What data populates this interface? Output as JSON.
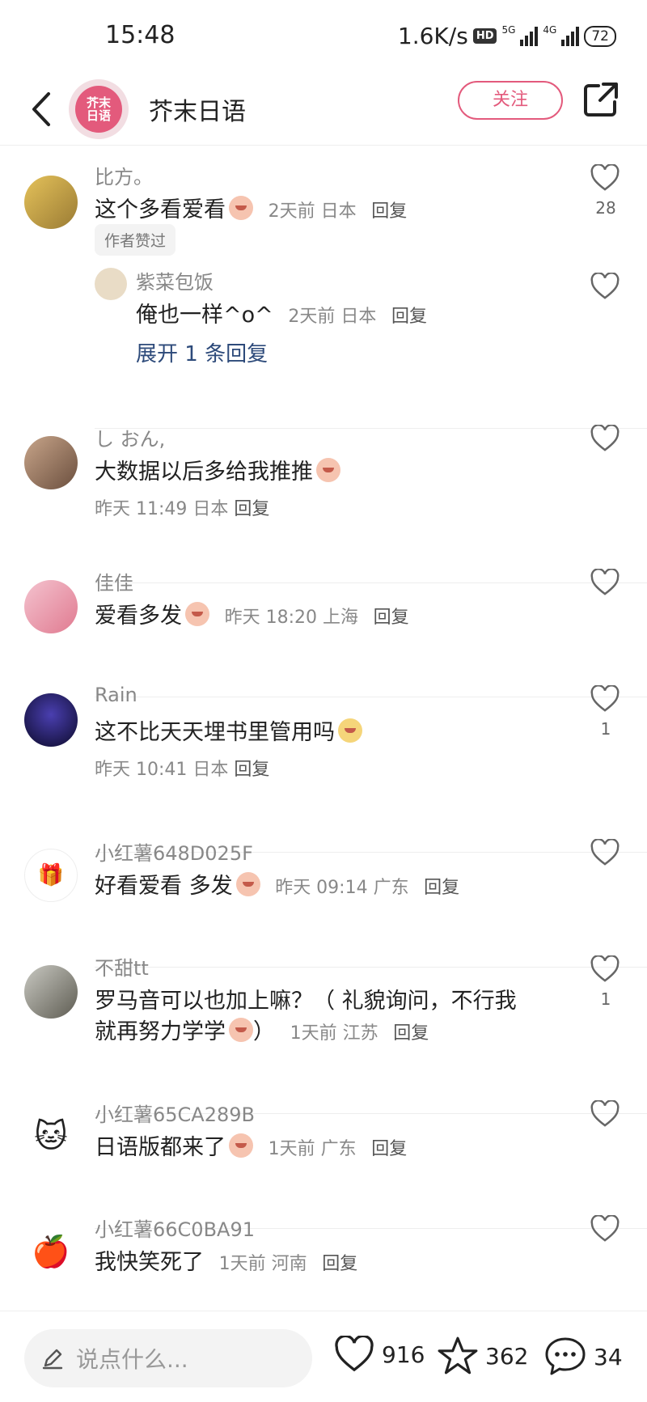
{
  "status_bar": {
    "time": "15:48",
    "speed": "1.6K/s",
    "hd": "HD",
    "net1": "5G",
    "net2": "4G",
    "battery": "72"
  },
  "header": {
    "account_name": "芥末日语",
    "avatar_text_top": "芥末",
    "avatar_text_bottom": "日语",
    "follow_label": "关注"
  },
  "comments": [
    {
      "user": "比方。",
      "text": "这个多看爱看",
      "meta": "2天前 日本",
      "reply": "回复",
      "likes": "28",
      "badge": "作者赞过",
      "sub_reply": {
        "user": "紫菜包饭",
        "text": "俺也一样^o^",
        "meta": "2天前 日本",
        "reply": "回复"
      },
      "expand": "展开 1 条回复"
    },
    {
      "user": "し おん,",
      "text": "大数据以后多给我推推",
      "meta": "昨天 11:49 日本",
      "reply": "回复"
    },
    {
      "user": "佳佳",
      "text": "爱看多发",
      "meta": "昨天 18:20 上海",
      "reply": "回复"
    },
    {
      "user": "Rain",
      "text": "这不比天天埋书里管用吗",
      "meta": "昨天 10:41 日本",
      "reply": "回复",
      "likes": "1"
    },
    {
      "user": "小红薯648D025F",
      "text": "好看爱看 多发",
      "meta": "昨天 09:14 广东",
      "reply": "回复"
    },
    {
      "user": "不甜tt",
      "text_line1": "罗马音可以也加上嘛？（ 礼貌询问，不行我",
      "text_line2": "就再努力学学",
      "text_tail": "）",
      "meta": "1天前 江苏",
      "reply": "回复",
      "likes": "1"
    },
    {
      "user": "小红薯65CA289B",
      "text": "日语版都来了",
      "meta": "1天前 广东",
      "reply": "回复"
    },
    {
      "user": "小红薯66C0BA91",
      "text": "我快笑死了",
      "meta": "1天前 河南",
      "reply": "回复"
    }
  ],
  "bottom_bar": {
    "placeholder": "说点什么...",
    "likes": "916",
    "stars": "362",
    "comments": "34"
  },
  "colors": {
    "accent": "#e35a7c",
    "link": "#2d4a7a"
  }
}
